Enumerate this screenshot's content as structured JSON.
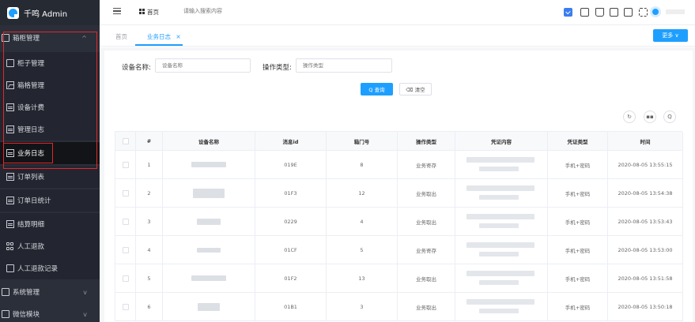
{
  "brand": {
    "name": "千鸣 Admin"
  },
  "sidebar": {
    "group1": {
      "label": "箱柜管理",
      "chevron": "^"
    },
    "items": [
      {
        "label": "柜子管理",
        "icon": "monitor-icon"
      },
      {
        "label": "箱格管理",
        "icon": "image-icon"
      },
      {
        "label": "设备计费",
        "icon": "bill-icon"
      },
      {
        "label": "管理日志",
        "icon": "log-icon"
      },
      {
        "label": "业务日志",
        "icon": "log-icon",
        "active": true
      },
      {
        "label": "订单列表",
        "icon": "list-icon"
      },
      {
        "label": "订单日统计",
        "icon": "stats-icon"
      },
      {
        "label": "结算明细",
        "icon": "settle-icon"
      },
      {
        "label": "人工退款",
        "icon": "grid-icon"
      },
      {
        "label": "人工退款记录",
        "icon": "people-icon"
      }
    ],
    "group2": {
      "label": "系统管理",
      "chevron": "v"
    },
    "group3": {
      "label": "微信模块",
      "chevron": "v"
    }
  },
  "header": {
    "home_label": "首页",
    "search_placeholder": "请输入搜索内容"
  },
  "tabs": {
    "home": "首页",
    "active": "业务日志",
    "close": "×",
    "more": "更多 ∨"
  },
  "filters": {
    "device_name_label": "设备名称:",
    "device_name_placeholder": "设备名称",
    "op_type_label": "操作类型:",
    "op_type_placeholder": "操作类型",
    "query_button": "Q 查询",
    "clear_button": "⌫ 清空"
  },
  "toolbar_icons": [
    "↻",
    "▪▪",
    "Q"
  ],
  "table": {
    "headers": [
      "",
      "#",
      "设备名称",
      "消息id",
      "箱门号",
      "操作类型",
      "凭证内容",
      "凭证类型",
      "时间"
    ],
    "rows": [
      {
        "index": "1",
        "msg_id": "019E",
        "door": "8",
        "op": "业务寄存",
        "cred_type": "手机+密码",
        "time": "2020-08-05 13:55:15"
      },
      {
        "index": "2",
        "msg_id": "01F3",
        "door": "12",
        "op": "业务取出",
        "cred_type": "手机+密码",
        "time": "2020-08-05 13:54:38"
      },
      {
        "index": "3",
        "msg_id": "0229",
        "door": "4",
        "op": "业务取出",
        "cred_type": "手机+密码",
        "time": "2020-08-05 13:53:43"
      },
      {
        "index": "4",
        "msg_id": "01CF",
        "door": "5",
        "op": "业务寄存",
        "cred_type": "手机+密码",
        "time": "2020-08-05 13:53:00"
      },
      {
        "index": "5",
        "msg_id": "01F2",
        "door": "13",
        "op": "业务取出",
        "cred_type": "手机+密码",
        "time": "2020-08-05 13:51:58"
      },
      {
        "index": "6",
        "msg_id": "01B1",
        "door": "3",
        "op": "业务取出",
        "cred_type": "手机+密码",
        "time": "2020-08-05 13:50:18"
      }
    ]
  },
  "colors": {
    "accent": "#1e9fff",
    "sidebar_bg": "#2b2f3a",
    "highlight_border": "#e02828"
  }
}
